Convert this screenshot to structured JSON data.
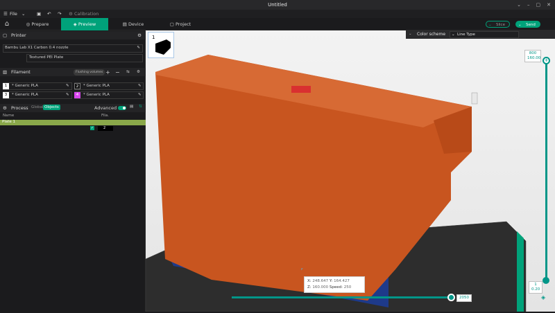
{
  "window": {
    "title": "Untitled",
    "controls": [
      "⌄",
      "–",
      "▢",
      "✕"
    ]
  },
  "menu": {
    "file": "File",
    "calibration": "Calibration"
  },
  "tabs": [
    "Prepare",
    "Preview",
    "Device",
    "Project"
  ],
  "toolbar": {
    "slice": "Slice",
    "send": "Send"
  },
  "printer": {
    "header": "Printer",
    "name": "Bambu Lab X1 Carbon 0.4 nozzle",
    "plate": "Textured PEI Plate"
  },
  "filament": {
    "header": "Filament",
    "flushing": "Flushing volumes",
    "slots": [
      {
        "num": "1",
        "name": "* Generic PLA",
        "color": "#ffffff"
      },
      {
        "num": "2",
        "name": "* Generic PLA",
        "color": "#111111"
      },
      {
        "num": "3",
        "name": "* Generic PLA",
        "color": "#ffffff"
      },
      {
        "num": "4",
        "name": "* Generic PLA",
        "color": "#d946ef"
      }
    ]
  },
  "process": {
    "header": "Process",
    "global": "Global",
    "objects": "Objects",
    "advanced": "Advanced"
  },
  "objects": {
    "col_name": "Name",
    "col_fila": "Fila.",
    "plate": "Plate 1",
    "fila_value": "2"
  },
  "thumb": {
    "label": "1"
  },
  "legend": {
    "header": "Color scheme",
    "value": "Line Type"
  },
  "layers": {
    "top_index": "800",
    "top_height": "160.00",
    "bottom_index": "1",
    "bottom_height": "0.20",
    "moves": "2050"
  },
  "tooltip": {
    "x_label": "X:",
    "x": "248.647",
    "y_label": "Y:",
    "y": "164.427",
    "z_label": "Z:",
    "z": "160.000",
    "speed_label": "Speed:",
    "speed": "250"
  },
  "colors": {
    "accent": "#00a27a",
    "model": "#c8551f",
    "model_top": "#d76a34",
    "outline": "#1e3a8a",
    "bed": "#2d2d2d"
  }
}
